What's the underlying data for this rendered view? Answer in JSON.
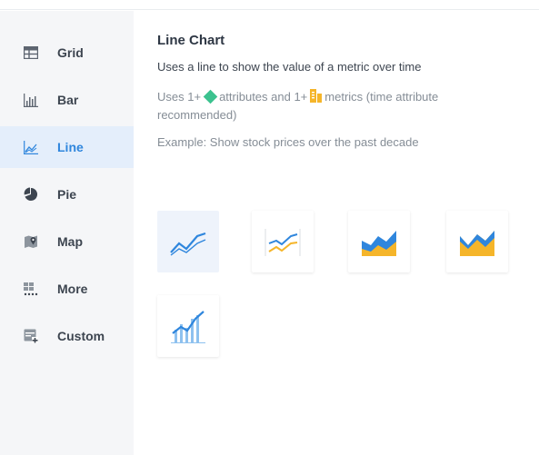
{
  "sidebar": {
    "items": [
      {
        "label": "Grid",
        "icon": "grid-icon"
      },
      {
        "label": "Bar",
        "icon": "bar-chart-icon"
      },
      {
        "label": "Line",
        "icon": "line-chart-icon",
        "active": true
      },
      {
        "label": "Pie",
        "icon": "pie-chart-icon"
      },
      {
        "label": "Map",
        "icon": "map-icon"
      },
      {
        "label": "More",
        "icon": "more-icon"
      },
      {
        "label": "Custom",
        "icon": "custom-icon"
      }
    ]
  },
  "main": {
    "title": "Line Chart",
    "description": "Uses a line to show the value of a metric over time",
    "requirement_prefix": "Uses 1+",
    "requirement_attributes": "attributes and 1+",
    "requirement_metrics": "metrics (time attribute recommended)",
    "example": "Example: Show stock prices over the past decade",
    "variants": [
      {
        "name": "line",
        "selected": true
      },
      {
        "name": "dual-axis-line"
      },
      {
        "name": "area"
      },
      {
        "name": "stacked-area"
      },
      {
        "name": "line-and-bar"
      }
    ]
  },
  "colors": {
    "accent": "#2f86dd",
    "active_bg": "#e4eefb",
    "attribute_green": "#3cc28f",
    "metric_orange": "#f5b52a",
    "chart_blue": "#2f86dd"
  }
}
